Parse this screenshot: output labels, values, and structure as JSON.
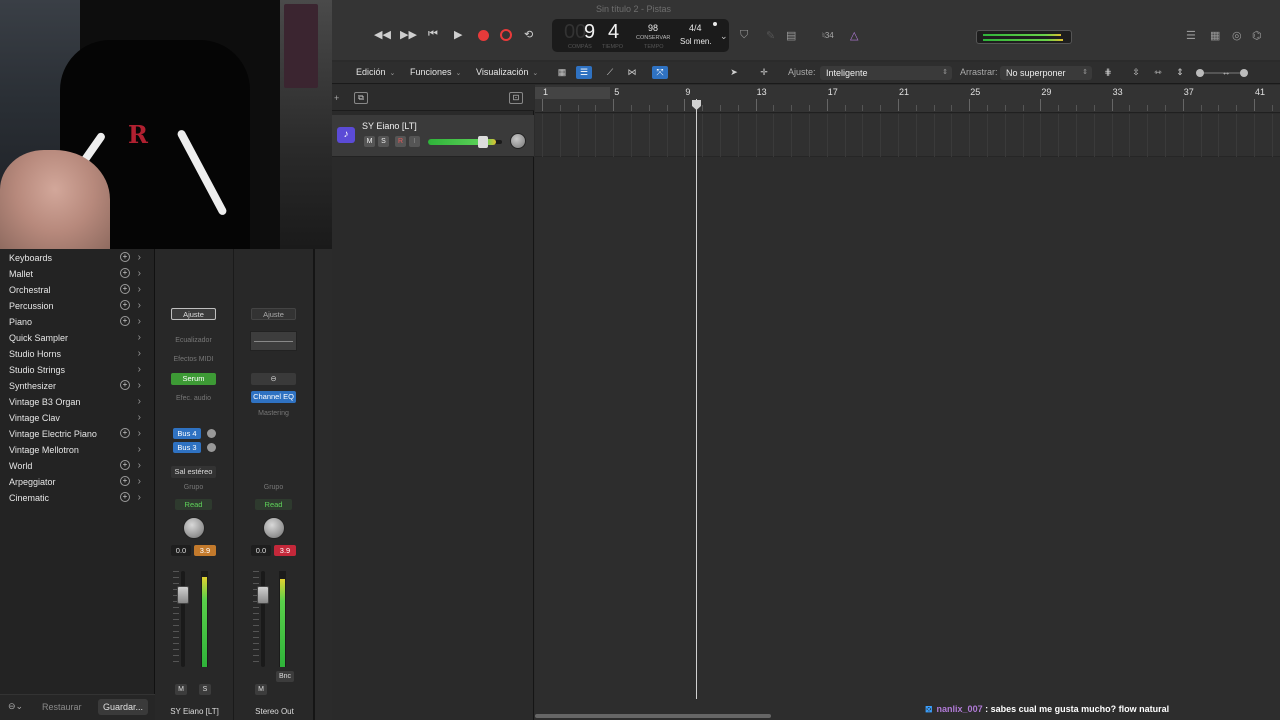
{
  "window": {
    "title": "Sin título 2 - Pistas"
  },
  "transport": {
    "bars": "9",
    "beat": "4",
    "bars_dim": "00",
    "bars_caption": "COMPÁS",
    "beat_caption": "TIEMPO",
    "tempo": "98",
    "tempo_mode": "CONSERVAR",
    "tempo_caption": "TEMPO",
    "signature": "4/4",
    "key": "Sol men.",
    "tuner": "♮34"
  },
  "menu": {
    "edit": "Edición",
    "functions": "Funciones",
    "view": "Visualización",
    "snap_label": "Ajuste:",
    "snap_value": "Inteligente",
    "drag_label": "Arrastrar:",
    "drag_value": "No superponer"
  },
  "library": {
    "items": [
      {
        "label": "Keyboards",
        "plus": true
      },
      {
        "label": "Mallet",
        "plus": true
      },
      {
        "label": "Orchestral",
        "plus": true
      },
      {
        "label": "Percussion",
        "plus": true
      },
      {
        "label": "Piano",
        "plus": true
      },
      {
        "label": "Quick Sampler",
        "plus": false
      },
      {
        "label": "Studio Horns",
        "plus": false
      },
      {
        "label": "Studio Strings",
        "plus": false
      },
      {
        "label": "Synthesizer",
        "plus": true
      },
      {
        "label": "Vintage B3 Organ",
        "plus": false
      },
      {
        "label": "Vintage Clav",
        "plus": false
      },
      {
        "label": "Vintage Electric Piano",
        "plus": true
      },
      {
        "label": "Vintage Mellotron",
        "plus": false
      },
      {
        "label": "World",
        "plus": true
      },
      {
        "label": "Arpeggiator",
        "plus": true
      },
      {
        "label": "Cinematic",
        "plus": true
      }
    ],
    "restore": "Restaurar",
    "save": "Guardar..."
  },
  "strips": {
    "a": {
      "setting": "Ajuste",
      "eq": "Ecualizador",
      "midi_fx": "Efectos MIDI",
      "instrument": "Serum",
      "audio_fx": "Efec. audio",
      "bus1": "Bus 4",
      "bus2": "Bus 3",
      "output": "Sal estéreo",
      "group": "Grupo",
      "automation": "Read",
      "volume": "0.0",
      "peak": "3.9",
      "mute": "M",
      "solo": "S",
      "name": "SY Eiano [LT]"
    },
    "b": {
      "setting": "Ajuste",
      "link": "⊖",
      "plugin": "Channel EQ",
      "mastering": "Mastering",
      "group": "Grupo",
      "automation": "Read",
      "volume": "0.0",
      "peak": "3.9",
      "mute": "M",
      "bounce": "Bnc",
      "name": "Stereo Out"
    }
  },
  "track": {
    "name": "SY Eiano [LT]",
    "mute": "M",
    "solo": "S",
    "record": "R",
    "input": "I"
  },
  "ruler": [
    "1",
    "5",
    "9",
    "13",
    "17",
    "21",
    "25",
    "29",
    "33",
    "37",
    "41"
  ],
  "chat": {
    "user": "nanlix_007",
    "message": " : sabes cual me gusta mucho? flow natural"
  },
  "colors": {
    "accent": "#2f72c2",
    "record": "#e83a3a",
    "green": "#3d9a35"
  }
}
